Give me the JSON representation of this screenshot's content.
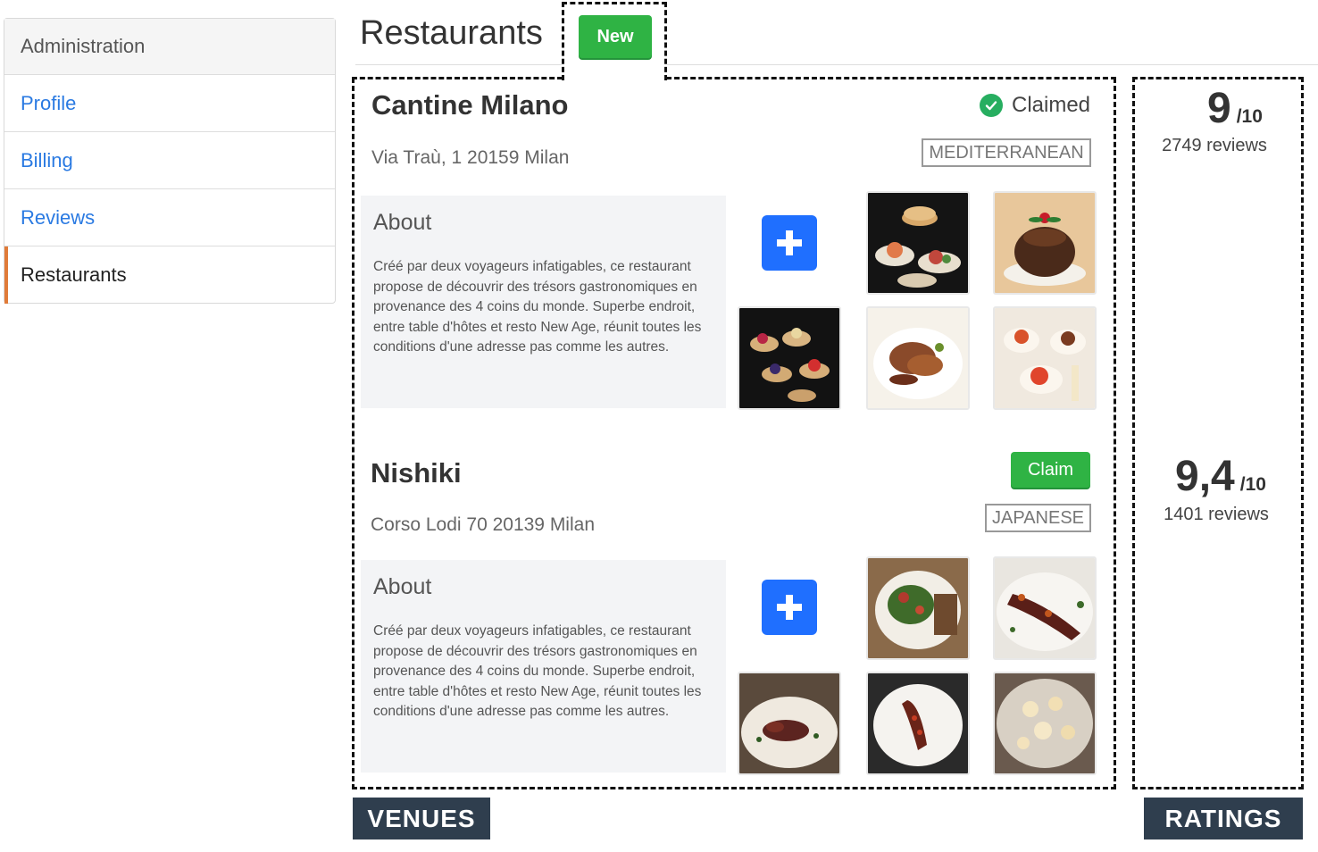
{
  "sidebar": {
    "header": "Administration",
    "items": [
      {
        "label": "Profile"
      },
      {
        "label": "Billing"
      },
      {
        "label": "Reviews"
      },
      {
        "label": "Restaurants"
      }
    ]
  },
  "header": {
    "title": "Restaurants",
    "new_label": "New"
  },
  "venues": [
    {
      "name": "Cantine Milano",
      "address": "Via Traù, 1 20159 Milan",
      "cuisine": "MEDITERRANEAN",
      "status": "Claimed",
      "about_title": "About",
      "about_text": "Créé par deux voyageurs infatigables, ce restaurant propose de découvrir des trésors gastronomiques en provenance des 4 coins du monde. Superbe endroit, entre table d'hôtes et resto New Age, réunit toutes les conditions d'une adresse pas comme les autres."
    },
    {
      "name": "Nishiki",
      "address": "Corso Lodi 70 20139 Milan",
      "cuisine": "JAPANESE",
      "claim_label": "Claim",
      "about_title": "About",
      "about_text": "Créé par deux voyageurs infatigables, ce restaurant propose de découvrir des trésors gastronomiques en provenance des 4 coins du monde. Superbe endroit, entre table d'hôtes et resto New Age, réunit toutes les conditions d'une adresse pas comme les autres."
    }
  ],
  "ratings": [
    {
      "score": "9",
      "out_of": "/10",
      "reviews": "2749 reviews"
    },
    {
      "score": "9,4",
      "out_of": "/10",
      "reviews": "1401 reviews"
    }
  ],
  "labels": {
    "venues": "VENUES",
    "ratings": "RATINGS"
  },
  "colors": {
    "accent_green": "#2fb344",
    "link_blue": "#2a7ae2",
    "add_blue": "#1f6fff",
    "label_bg": "#2f3e4e",
    "active_marker": "#e07b39"
  },
  "icons": {
    "claimed": "check-badge-icon",
    "add_photo": "plus-icon"
  }
}
